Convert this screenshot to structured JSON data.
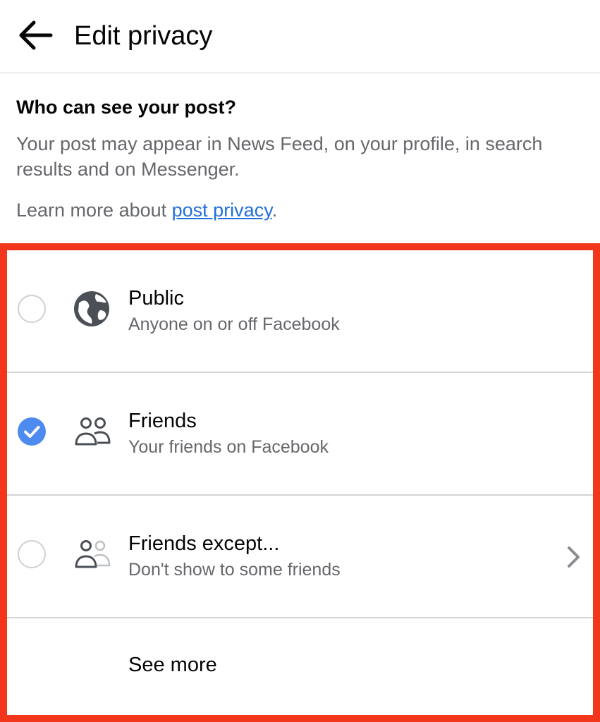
{
  "header": {
    "title": "Edit privacy",
    "back_icon": "arrow-left-icon"
  },
  "intro": {
    "heading": "Who can see your post?",
    "description": "Your post may appear in News Feed, on your profile, in search results and on Messenger.",
    "learn_prefix": "Learn more about ",
    "learn_link": "post privacy",
    "learn_suffix": "."
  },
  "options": [
    {
      "title": "Public",
      "subtitle": "Anyone on or off Facebook",
      "icon": "globe-icon",
      "selected": false
    },
    {
      "title": "Friends",
      "subtitle": "Your friends on Facebook",
      "icon": "friends-icon",
      "selected": true
    },
    {
      "title": "Friends except...",
      "subtitle": "Don't show to some friends",
      "icon": "friends-except-icon",
      "selected": false,
      "chevron": "chevron-right-icon"
    }
  ],
  "see_more": "See more",
  "colors": {
    "highlight_border": "#f2361b",
    "selected_radio": "#4d8bf0",
    "link": "#216fdb",
    "secondary_text": "#65676b"
  }
}
